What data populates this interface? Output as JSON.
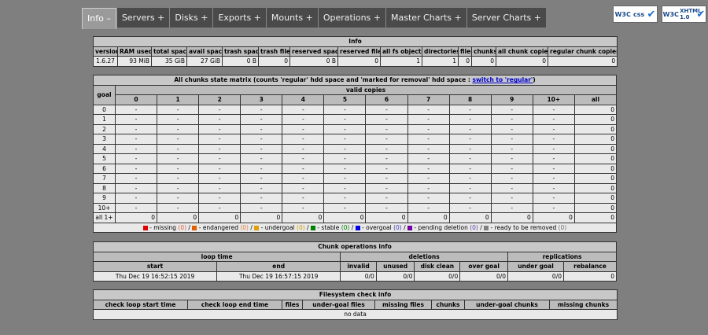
{
  "tabs": [
    {
      "label": "Info –",
      "active": true
    },
    {
      "label": "Servers +"
    },
    {
      "label": "Disks +"
    },
    {
      "label": "Exports +"
    },
    {
      "label": "Mounts +"
    },
    {
      "label": "Operations +"
    },
    {
      "label": "Master Charts +"
    },
    {
      "label": "Server Charts +"
    }
  ],
  "badges": [
    {
      "logo": "W3C",
      "text": "css"
    },
    {
      "logo": "W3C",
      "text": "XHTML 1.0"
    }
  ],
  "info": {
    "title": "Info",
    "headers": [
      "version",
      "RAM used",
      "total space",
      "avail space",
      "trash space",
      "trash files",
      "reserved space",
      "reserved files",
      "all fs objects",
      "directories",
      "files",
      "chunks",
      "all chunk copies",
      "regular chunk copies"
    ],
    "values": [
      "1.6.27",
      "93 MiB",
      "35 GiB",
      "27 GiB",
      "0 B",
      "0",
      "0 B",
      "0",
      "1",
      "1",
      "0",
      "0",
      "0",
      "0"
    ]
  },
  "matrix": {
    "title": "All chunks state matrix (counts 'regular' hdd space and 'marked for removal' hdd space : ",
    "title_end": ")",
    "switch_link": "switch to 'regular'",
    "goal_label": "goal",
    "valid_copies_label": "valid copies",
    "columns": [
      "0",
      "1",
      "2",
      "3",
      "4",
      "5",
      "6",
      "7",
      "8",
      "9",
      "10+",
      "all"
    ],
    "rows": [
      {
        "goal": "0",
        "cells": [
          "-",
          "-",
          "-",
          "-",
          "-",
          "-",
          "-",
          "-",
          "-",
          "-",
          "-",
          "0"
        ]
      },
      {
        "goal": "1",
        "cells": [
          "-",
          "-",
          "-",
          "-",
          "-",
          "-",
          "-",
          "-",
          "-",
          "-",
          "-",
          "0"
        ]
      },
      {
        "goal": "2",
        "cells": [
          "-",
          "-",
          "-",
          "-",
          "-",
          "-",
          "-",
          "-",
          "-",
          "-",
          "-",
          "0"
        ]
      },
      {
        "goal": "3",
        "cells": [
          "-",
          "-",
          "-",
          "-",
          "-",
          "-",
          "-",
          "-",
          "-",
          "-",
          "-",
          "0"
        ]
      },
      {
        "goal": "4",
        "cells": [
          "-",
          "-",
          "-",
          "-",
          "-",
          "-",
          "-",
          "-",
          "-",
          "-",
          "-",
          "0"
        ]
      },
      {
        "goal": "5",
        "cells": [
          "-",
          "-",
          "-",
          "-",
          "-",
          "-",
          "-",
          "-",
          "-",
          "-",
          "-",
          "0"
        ]
      },
      {
        "goal": "6",
        "cells": [
          "-",
          "-",
          "-",
          "-",
          "-",
          "-",
          "-",
          "-",
          "-",
          "-",
          "-",
          "0"
        ]
      },
      {
        "goal": "7",
        "cells": [
          "-",
          "-",
          "-",
          "-",
          "-",
          "-",
          "-",
          "-",
          "-",
          "-",
          "-",
          "0"
        ]
      },
      {
        "goal": "8",
        "cells": [
          "-",
          "-",
          "-",
          "-",
          "-",
          "-",
          "-",
          "-",
          "-",
          "-",
          "-",
          "0"
        ]
      },
      {
        "goal": "9",
        "cells": [
          "-",
          "-",
          "-",
          "-",
          "-",
          "-",
          "-",
          "-",
          "-",
          "-",
          "-",
          "0"
        ]
      },
      {
        "goal": "10+",
        "cells": [
          "-",
          "-",
          "-",
          "-",
          "-",
          "-",
          "-",
          "-",
          "-",
          "-",
          "-",
          "0"
        ]
      },
      {
        "goal": "all 1+",
        "cells": [
          "0",
          "0",
          "0",
          "0",
          "0",
          "0",
          "0",
          "0",
          "0",
          "0",
          "0",
          "0"
        ]
      }
    ],
    "legend": [
      {
        "color": "#e00000",
        "label": " - missing ",
        "count": "(0)",
        "count_color": "#e06040"
      },
      {
        "color": "#e06000",
        "label": " - endangered ",
        "count": "(0)",
        "count_color": "#e08040"
      },
      {
        "color": "#e0a000",
        "label": " - undergoal ",
        "count": "(0)",
        "count_color": "#d0a000"
      },
      {
        "color": "#008000",
        "label": " - stable ",
        "count": "(0)",
        "count_color": "#008000"
      },
      {
        "color": "#0000e0",
        "label": " - overgoal ",
        "count": "(0)",
        "count_color": "#4040c0"
      },
      {
        "color": "#7000a0",
        "label": " - pending deletion ",
        "count": "(0)",
        "count_color": "#6040a0"
      },
      {
        "color": "#808080",
        "label": " - ready to be removed ",
        "count": "(0)",
        "count_color": "#707070"
      }
    ]
  },
  "chunkops": {
    "title": "Chunk operations info",
    "groups": [
      "loop time",
      "deletions",
      "replications"
    ],
    "headers": [
      "start",
      "end",
      "invalid",
      "unused",
      "disk clean",
      "over goal",
      "under goal",
      "rebalance"
    ],
    "values": [
      "Thu Dec 19 16:52:15 2019",
      "Thu Dec 19 16:57:15 2019",
      "0/0",
      "0/0",
      "0/0",
      "0/0",
      "0/0",
      "0"
    ]
  },
  "fscheck": {
    "title": "Filesystem check info",
    "headers": [
      "check loop start time",
      "check loop end time",
      "files",
      "under-goal files",
      "missing files",
      "chunks",
      "under-goal chunks",
      "missing chunks"
    ],
    "empty": "no data"
  }
}
